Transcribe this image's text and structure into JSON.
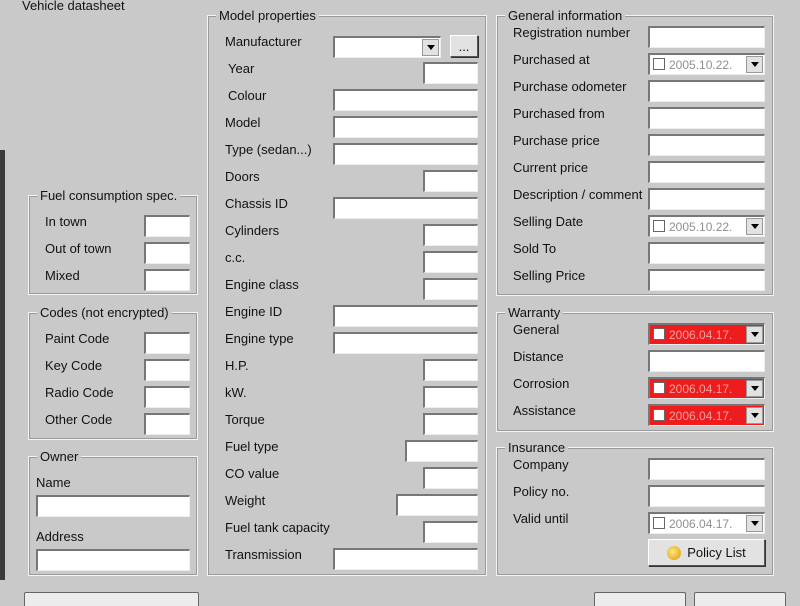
{
  "window": {
    "title": "Vehicle datasheet"
  },
  "fuel": {
    "title": "Fuel consumption spec.",
    "in_town": "In town",
    "out_of_town": "Out of town",
    "mixed": "Mixed"
  },
  "codes": {
    "title": "Codes (not encrypted)",
    "paint": "Paint Code",
    "key": "Key Code",
    "radio": "Radio Code",
    "other": "Other Code"
  },
  "owner": {
    "title": "Owner",
    "name": "Name",
    "address": "Address"
  },
  "model": {
    "title": "Model properties",
    "manufacturer": "Manufacturer",
    "browse_label": "...",
    "year": "Year",
    "colour": "Colour",
    "model": "Model",
    "type": "Type (sedan...)",
    "doors": "Doors",
    "chassis": "Chassis ID",
    "cylinders": "Cylinders",
    "cc": "c.c.",
    "engine_class": "Engine class",
    "engine_id": "Engine ID",
    "engine_type": "Engine type",
    "hp": "H.P.",
    "kw": "kW.",
    "torque": "Torque",
    "fuel_type": "Fuel type",
    "co_value": "CO value",
    "weight": "Weight",
    "tank": "Fuel tank capacity",
    "transmission": "Transmission"
  },
  "general": {
    "title": "General information",
    "registration": "Registration number",
    "purchased_at": "Purchased at",
    "purchased_at_value": "2005.10.22.",
    "odometer": "Purchase odometer",
    "purchased_from": "Purchased from",
    "purchase_price": "Purchase price",
    "current_price": "Current price",
    "description": "Description / comment",
    "selling_date": "Selling Date",
    "selling_date_value": "2005.10.22.",
    "sold_to": "Sold To",
    "selling_price": "Selling Price"
  },
  "warranty": {
    "title": "Warranty",
    "general": "General",
    "general_value": "2006.04.17.",
    "distance": "Distance",
    "corrosion": "Corrosion",
    "corrosion_value": "2006.04.17.",
    "assistance": "Assistance",
    "assistance_value": "2006.04.17."
  },
  "insurance": {
    "title": "Insurance",
    "company": "Company",
    "policy_no": "Policy no.",
    "valid_until": "Valid until",
    "valid_until_value": "2006.04.17.",
    "policy_list": "Policy List"
  },
  "colors": {
    "background": "#c9c9c9",
    "expired_date": "#ee1c1c"
  },
  "icons": {
    "policy_list": "coin-icon",
    "dropdown": "chevron-down-icon"
  }
}
